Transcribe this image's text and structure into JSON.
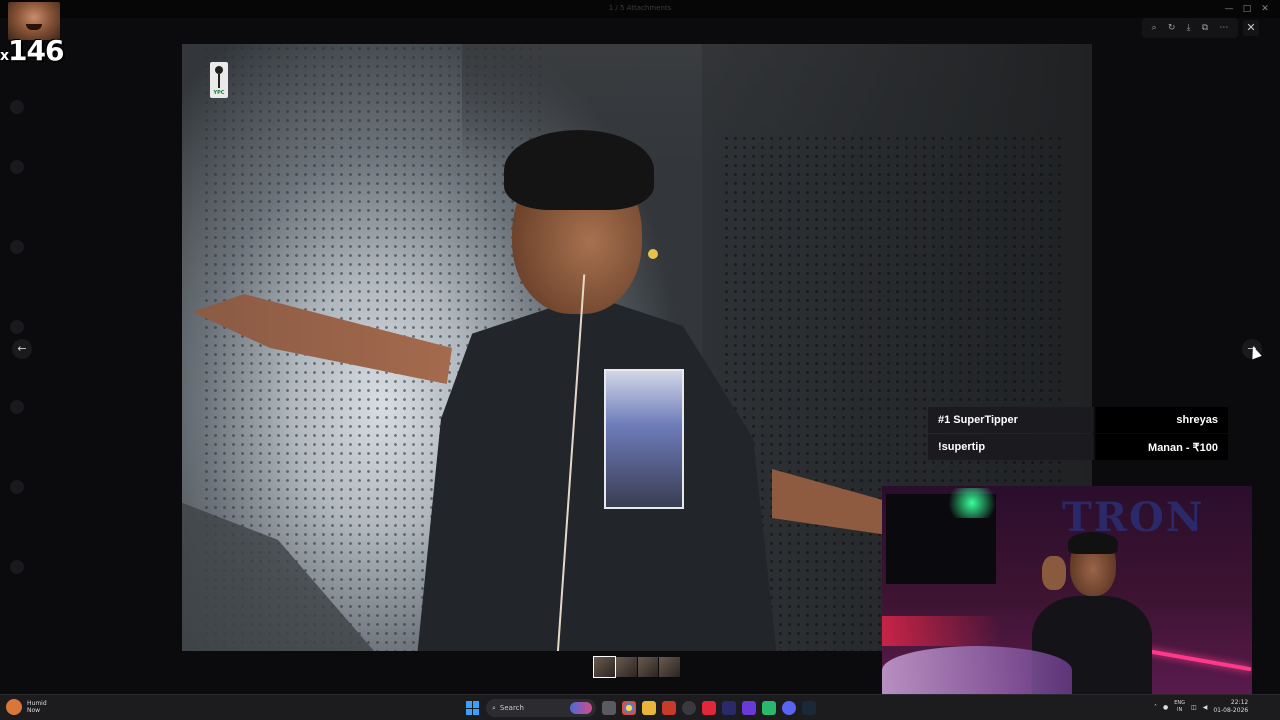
{
  "window": {
    "title": "1 / 5 Attachments"
  },
  "stream_overlay": {
    "combo_prefix": "x",
    "combo_count": "146"
  },
  "viewer": {
    "toolbar_icons": [
      "zoom-icon",
      "rotate-icon",
      "download-icon",
      "open-external-icon",
      "more-icon"
    ],
    "close_label": "✕",
    "prev_label": "←",
    "next_label": "→",
    "thumbnail_count": 4,
    "photo_logo_text": "YPC"
  },
  "super_tipper": {
    "row1_label": "#1 SuperTipper",
    "row1_value": "shreyas",
    "row2_label": "!supertip",
    "row2_value": "Manan - ₹100"
  },
  "facecam": {
    "sign_text": "TRON"
  },
  "taskbar": {
    "weather_title": "Humid",
    "weather_sub": "Now",
    "search_placeholder": "Search",
    "lang_top": "ENG",
    "lang_bottom": "IN",
    "time": "22:12",
    "date": "01-08-2026"
  },
  "colors": {
    "accent_start": "#3aa0ff",
    "tipper_bg": "#1b1b1f",
    "led": "#ff3a8a"
  }
}
